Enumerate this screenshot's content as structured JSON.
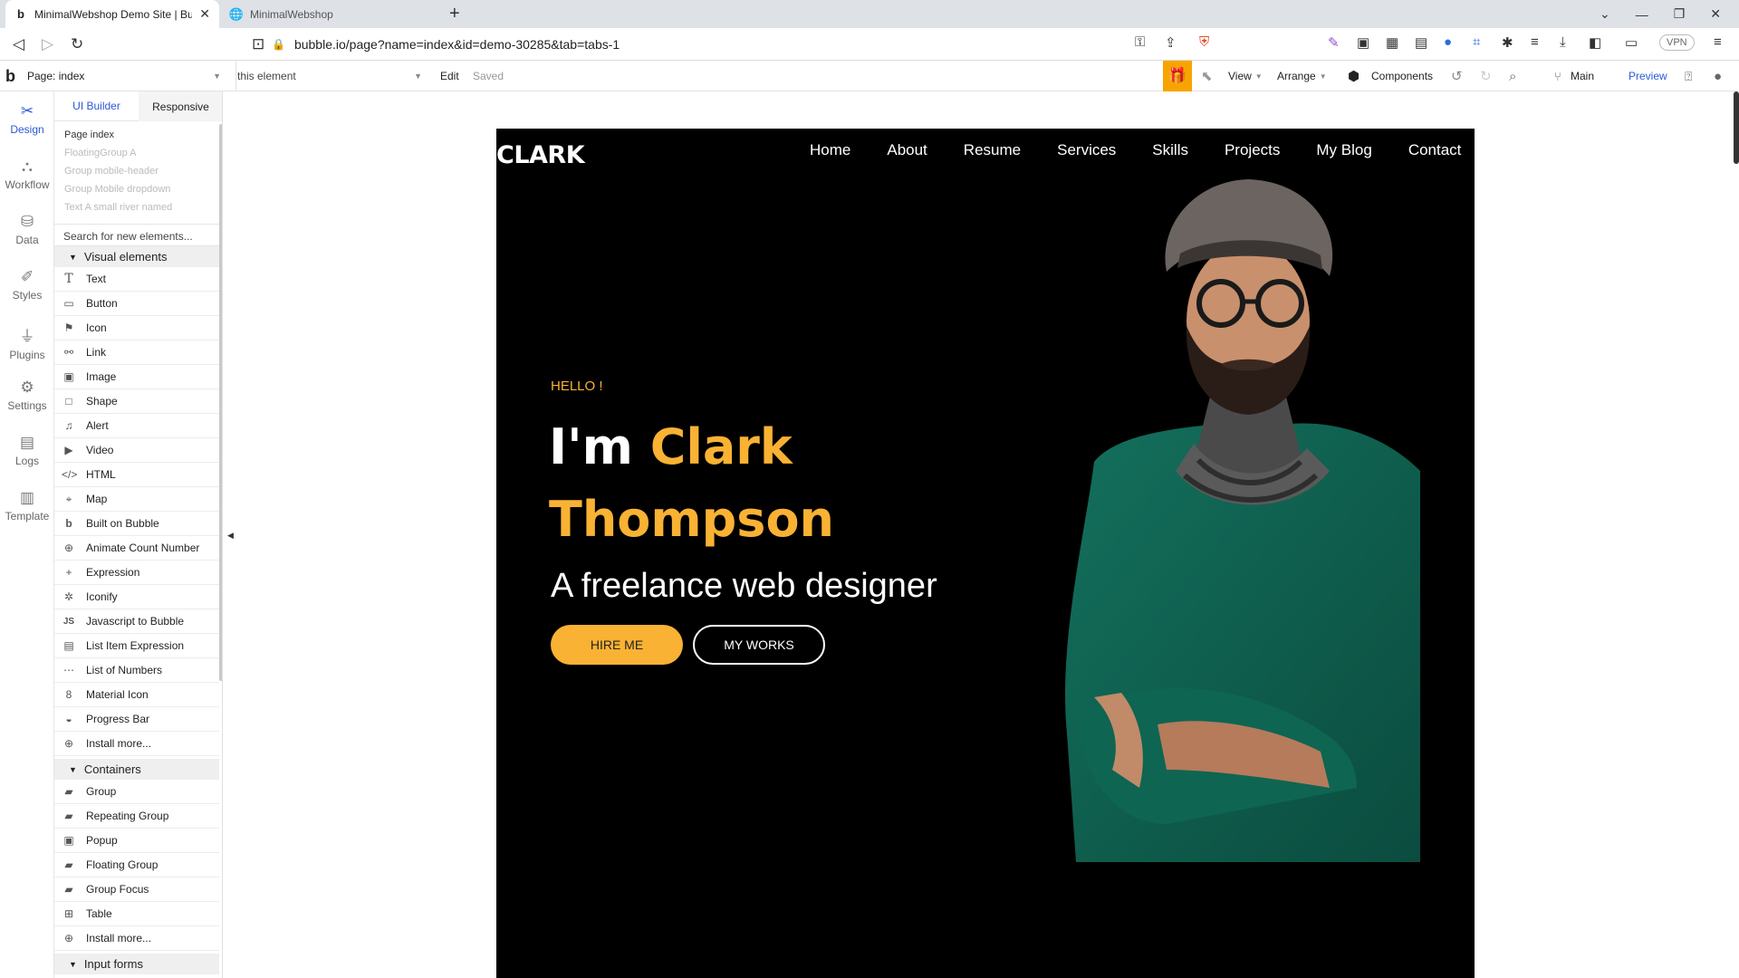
{
  "browser": {
    "tabs": [
      {
        "title": "MinimalWebshop Demo Site | Bu",
        "favicon": "b"
      },
      {
        "title": "MinimalWebshop",
        "favicon": "globe-icon"
      }
    ],
    "url": "bubble.io/page?name=index&id=demo-30285&tab=tabs-1",
    "vpn_label": "VPN"
  },
  "toolbar": {
    "page_selector": "Page: index",
    "element_selector": "this element",
    "edit_label": "Edit",
    "saved_label": "Saved",
    "view_label": "View",
    "arrange_label": "Arrange",
    "components_label": "Components",
    "branch_label": "Main",
    "preview_label": "Preview"
  },
  "rail": {
    "items": [
      {
        "label": "Design",
        "icon": "design-icon"
      },
      {
        "label": "Workflow",
        "icon": "workflow-icon"
      },
      {
        "label": "Data",
        "icon": "data-icon"
      },
      {
        "label": "Styles",
        "icon": "styles-icon"
      },
      {
        "label": "Plugins",
        "icon": "plugins-icon"
      },
      {
        "label": "Settings",
        "icon": "settings-icon"
      },
      {
        "label": "Logs",
        "icon": "logs-icon"
      },
      {
        "label": "Template",
        "icon": "template-icon"
      }
    ]
  },
  "panel": {
    "tabs": [
      "UI Builder",
      "Responsive"
    ],
    "tree": [
      "Page index",
      "FloatingGroup A",
      "Group mobile-header",
      "Group Mobile dropdown",
      "Text A small river named"
    ],
    "search_placeholder": "Search for new elements...",
    "sections": {
      "visual": "Visual elements",
      "containers": "Containers",
      "inputs": "Input forms"
    },
    "visual_items": [
      "Text",
      "Button",
      "Icon",
      "Link",
      "Image",
      "Shape",
      "Alert",
      "Video",
      "HTML",
      "Map",
      "Built on Bubble",
      "Animate Count Number",
      "Expression",
      "Iconify",
      "Javascript to Bubble",
      "List Item Expression",
      "List of Numbers",
      "Material Icon",
      "Progress Bar",
      "Install more..."
    ],
    "container_items": [
      "Group",
      "Repeating Group",
      "Popup",
      "Floating Group",
      "Group Focus",
      "Table",
      "Install more..."
    ]
  },
  "site": {
    "logo": "CLARK",
    "nav": [
      "Home",
      "About",
      "Resume",
      "Services",
      "Skills",
      "Projects",
      "My Blog",
      "Contact"
    ],
    "hello": "HELLO !",
    "im": "I'm",
    "first_name": "Clark",
    "last_name": "Thompson",
    "subtitle": "A freelance web designer",
    "hire_me": "HIRE ME",
    "my_works": "MY WORKS"
  },
  "colors": {
    "accent": "#f9b233",
    "bubble_blue": "#2c59d6",
    "sweater": "#0f5f4e"
  }
}
